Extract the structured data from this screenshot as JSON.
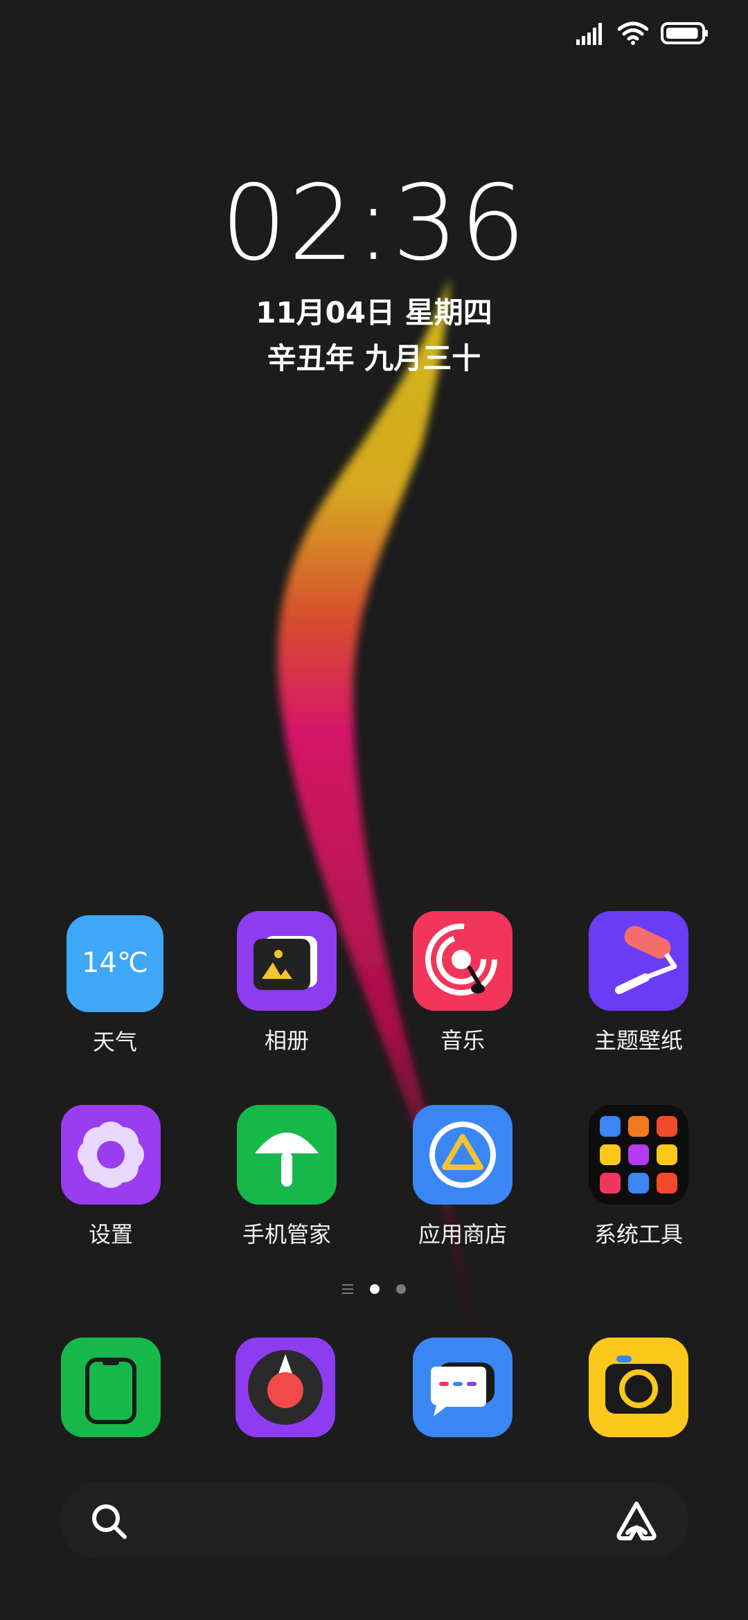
{
  "status_bar": {
    "signal_icon": "signal-bars-icon",
    "wifi_icon": "wifi-icon",
    "battery_icon": "battery-icon",
    "battery_level": 0.95
  },
  "clock": {
    "time": "02:36",
    "date": "11月04日 星期四",
    "lunar": "辛丑年 九月三十"
  },
  "apps": [
    {
      "label": "天气",
      "icon": "weather-icon",
      "icon_text": "14℃",
      "color": "#3ea7f7"
    },
    {
      "label": "相册",
      "icon": "gallery-icon",
      "color": "#8e3cf0"
    },
    {
      "label": "音乐",
      "icon": "music-icon",
      "color": "#f2355a"
    },
    {
      "label": "主题壁纸",
      "icon": "theme-paint-roller-icon",
      "color": "#6a3cf5"
    },
    {
      "label": "设置",
      "icon": "settings-flower-icon",
      "color": "#9a3cf0"
    },
    {
      "label": "手机管家",
      "icon": "security-umbrella-icon",
      "color": "#16b84a"
    },
    {
      "label": "应用商店",
      "icon": "app-store-triangle-icon",
      "color": "#3a86f2"
    },
    {
      "label": "系统工具",
      "icon": "system-tools-folder-icon",
      "color": "#0d0d0d"
    }
  ],
  "page_indicator": {
    "pages": 2,
    "active": 0
  },
  "dock": [
    {
      "name": "phone",
      "icon": "phone-icon",
      "color": "#16b84a"
    },
    {
      "name": "browser",
      "icon": "browser-compass-icon",
      "color": "#8e3cf0"
    },
    {
      "name": "messages",
      "icon": "messages-icon",
      "color": "#3a86f2"
    },
    {
      "name": "camera",
      "icon": "camera-icon",
      "color": "#fcc81c"
    }
  ],
  "search_bar": {
    "search_icon": "search-icon",
    "assistant_icon": "assistant-icon"
  }
}
